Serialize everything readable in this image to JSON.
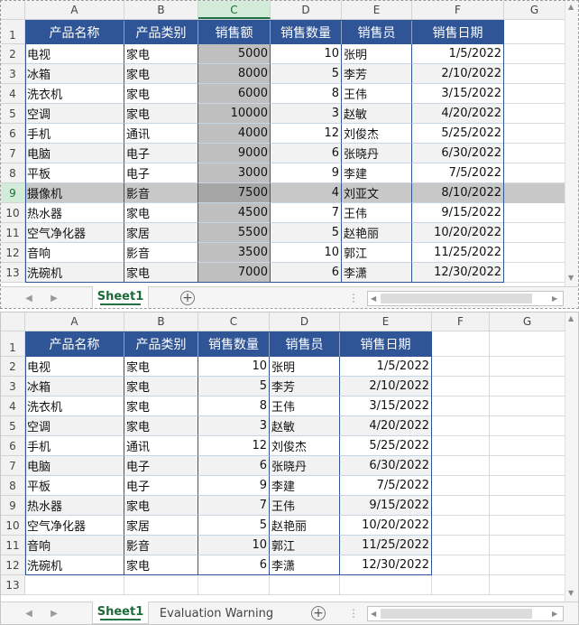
{
  "top": {
    "columns": [
      "A",
      "B",
      "C",
      "D",
      "E",
      "F",
      "G"
    ],
    "selected_column": "C",
    "selected_row": 9,
    "headers": [
      "产品名称",
      "产品类别",
      "销售额",
      "销售数量",
      "销售员",
      "销售日期"
    ],
    "rows": [
      [
        "电视",
        "家电",
        "5000",
        "10",
        "张明",
        "1/5/2022"
      ],
      [
        "冰箱",
        "家电",
        "8000",
        "5",
        "李芳",
        "2/10/2022"
      ],
      [
        "洗衣机",
        "家电",
        "6000",
        "8",
        "王伟",
        "3/15/2022"
      ],
      [
        "空调",
        "家电",
        "10000",
        "3",
        "赵敏",
        "4/20/2022"
      ],
      [
        "手机",
        "通讯",
        "4000",
        "12",
        "刘俊杰",
        "5/25/2022"
      ],
      [
        "电脑",
        "电子",
        "9000",
        "6",
        "张晓丹",
        "6/30/2022"
      ],
      [
        "平板",
        "电子",
        "3000",
        "9",
        "李建",
        "7/5/2022"
      ],
      [
        "摄像机",
        "影音",
        "7500",
        "4",
        "刘亚文",
        "8/10/2022"
      ],
      [
        "热水器",
        "家电",
        "4500",
        "7",
        "王伟",
        "9/15/2022"
      ],
      [
        "空气净化器",
        "家居",
        "5500",
        "5",
        "赵艳丽",
        "10/20/2022"
      ],
      [
        "音响",
        "影音",
        "3500",
        "10",
        "郭江",
        "11/25/2022"
      ],
      [
        "洗碗机",
        "家电",
        "7000",
        "6",
        "李潇",
        "12/30/2022"
      ]
    ],
    "tabs": [
      "Sheet1"
    ],
    "add_sheet": "+"
  },
  "bottom": {
    "columns": [
      "A",
      "B",
      "C",
      "D",
      "E",
      "F",
      "G"
    ],
    "headers": [
      "产品名称",
      "产品类别",
      "销售数量",
      "销售员",
      "销售日期"
    ],
    "rows": [
      [
        "电视",
        "家电",
        "10",
        "张明",
        "1/5/2022"
      ],
      [
        "冰箱",
        "家电",
        "5",
        "李芳",
        "2/10/2022"
      ],
      [
        "洗衣机",
        "家电",
        "8",
        "王伟",
        "3/15/2022"
      ],
      [
        "空调",
        "家电",
        "3",
        "赵敏",
        "4/20/2022"
      ],
      [
        "手机",
        "通讯",
        "12",
        "刘俊杰",
        "5/25/2022"
      ],
      [
        "电脑",
        "电子",
        "6",
        "张晓丹",
        "6/30/2022"
      ],
      [
        "平板",
        "电子",
        "9",
        "李建",
        "7/5/2022"
      ],
      [
        "热水器",
        "家电",
        "7",
        "王伟",
        "9/15/2022"
      ],
      [
        "空气净化器",
        "家居",
        "5",
        "赵艳丽",
        "10/20/2022"
      ],
      [
        "音响",
        "影音",
        "10",
        "郭江",
        "11/25/2022"
      ],
      [
        "洗碗机",
        "家电",
        "6",
        "李潇",
        "12/30/2022"
      ]
    ],
    "tabs": [
      "Sheet1",
      "Evaluation Warning"
    ],
    "add_sheet": "+"
  },
  "colors": {
    "header_fill": "#2f5597",
    "band_fill": "#f2f2f2",
    "selected_col_fill": "#bfbfbf",
    "selected_row_fill": "#c8c8c8",
    "selected_cell_fill": "#a6a6a6",
    "accent": "#217346"
  },
  "icons": [
    "nav-left-icon",
    "nav-right-icon",
    "add-sheet-icon",
    "scroll-left-icon",
    "scroll-right-icon",
    "scroll-up-icon",
    "scroll-down-icon"
  ]
}
